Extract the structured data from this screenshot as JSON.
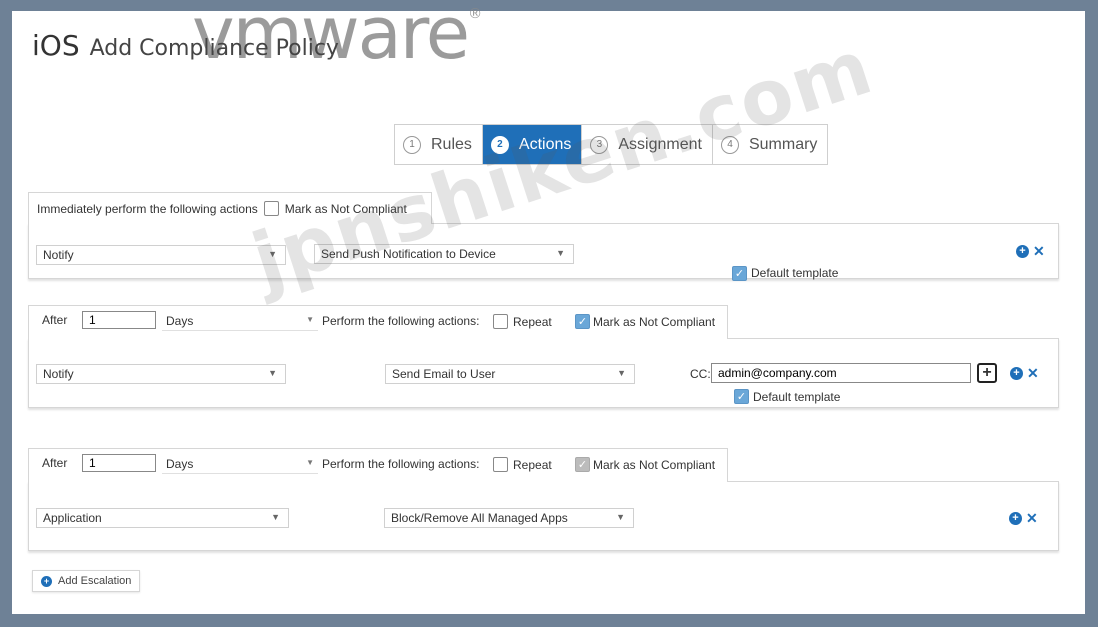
{
  "watermark_logo": "vmware",
  "watermark_text": "jpnshiken.com",
  "header": {
    "os_label": "iOS",
    "page_title": "Add Compliance Policy"
  },
  "wizard": {
    "steps": [
      {
        "num": "1",
        "label": "Rules"
      },
      {
        "num": "2",
        "label": "Actions"
      },
      {
        "num": "3",
        "label": "Assignment"
      },
      {
        "num": "4",
        "label": "Summary"
      }
    ],
    "active_step": "Actions"
  },
  "block1": {
    "tab_label": "Immediately perform the following actions",
    "mark_not_compliant_label": "Mark as Not Compliant",
    "mark_not_compliant_checked": false,
    "action_type": "Notify",
    "action_value": "Send Push Notification to Device",
    "default_template_label": "Default template",
    "default_template_checked": true
  },
  "block2": {
    "after_label": "After",
    "after_value": "1",
    "unit": "Days",
    "perform_label": "Perform the following actions:",
    "repeat_label": "Repeat",
    "repeat_checked": false,
    "mark_not_compliant_label": "Mark as Not Compliant",
    "mark_not_compliant_checked": true,
    "action_type": "Notify",
    "action_value": "Send Email to User",
    "cc_label": "CC:",
    "cc_value": "admin@company.com",
    "default_template_label": "Default template",
    "default_template_checked": true
  },
  "block3": {
    "after_label": "After",
    "after_value": "1",
    "unit": "Days",
    "perform_label": "Perform the following actions:",
    "repeat_label": "Repeat",
    "repeat_checked": false,
    "mark_not_compliant_label": "Mark as Not Compliant",
    "mark_not_compliant_checked": true,
    "action_type": "Application",
    "action_value": "Block/Remove All Managed Apps"
  },
  "add_escalation_label": "Add Escalation",
  "colors": {
    "accent": "#1f6fb8",
    "frame": "#6e8196"
  }
}
